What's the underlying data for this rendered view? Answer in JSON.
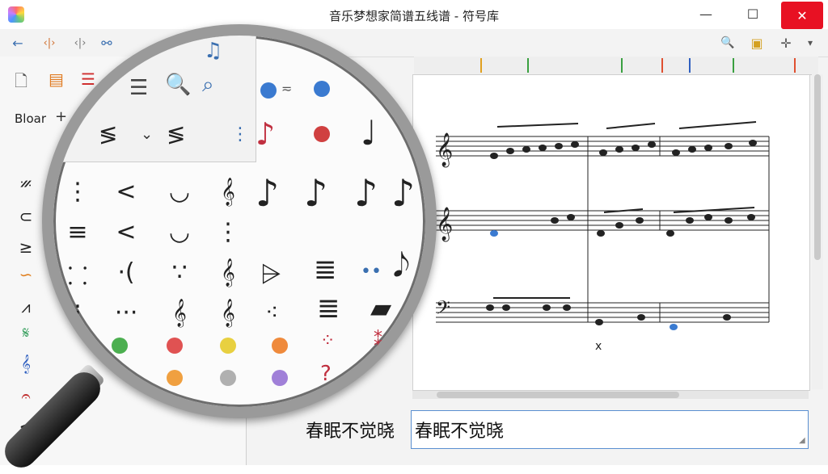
{
  "window": {
    "title": "音乐梦想家简谱五线谱 - 符号库",
    "minimize": "—",
    "maximize": "☐",
    "close": "✕"
  },
  "toolbar": {
    "back_icon": "←",
    "code_left_icon": "‹|›",
    "code_right_icon": "‹|›",
    "link_icon": "⚯",
    "zoom_icon": "🔍",
    "move_icon": "✛",
    "dropdown_icon": "▾"
  },
  "library": {
    "group_label": "Bloar",
    "add_label": "+",
    "more_label": "⋮",
    "dropdown_label": "⌄"
  },
  "score": {
    "lyric_marker": "x"
  },
  "input": {
    "left_text": "春眠不觉晓",
    "right_text": "春眠不觉晓"
  },
  "magnifier": {
    "symbols_col1": [
      "⋮",
      "≡",
      "⸬",
      "⁝"
    ],
    "symbols_col2": [
      "<",
      "<",
      "⋅(",
      "⋅⋅⋅"
    ],
    "symbols_col3": [
      "◡",
      "◡",
      "∵",
      "𝄞"
    ],
    "symbols_col4": [
      "𝄞",
      "⋮",
      "𝄞",
      "𝄞"
    ],
    "dots_row1": [
      "#4caf50",
      "#e05252",
      "#e8d040",
      "#ef8a3c"
    ],
    "dots_row2": [
      "#b07ad8",
      "#f0a040",
      "#b0b0b0",
      "#a080d8"
    ],
    "note_glyph": "♪",
    "quarter_glyph": "♩",
    "flag_glyph": "𝅘𝅥𝅮"
  }
}
